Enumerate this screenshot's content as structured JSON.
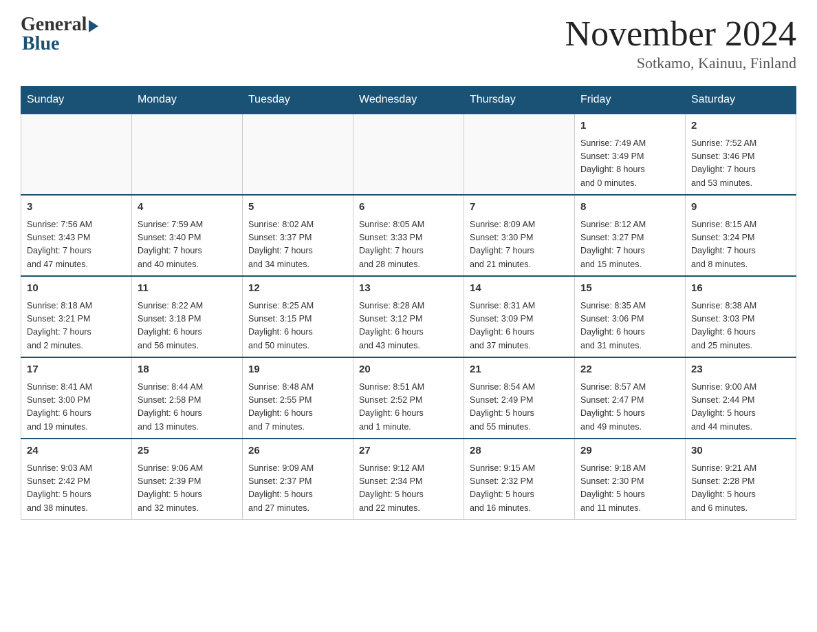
{
  "logo": {
    "general": "General",
    "blue": "Blue"
  },
  "title": "November 2024",
  "location": "Sotkamo, Kainuu, Finland",
  "days_of_week": [
    "Sunday",
    "Monday",
    "Tuesday",
    "Wednesday",
    "Thursday",
    "Friday",
    "Saturday"
  ],
  "weeks": [
    [
      {
        "day": "",
        "info": ""
      },
      {
        "day": "",
        "info": ""
      },
      {
        "day": "",
        "info": ""
      },
      {
        "day": "",
        "info": ""
      },
      {
        "day": "",
        "info": ""
      },
      {
        "day": "1",
        "info": "Sunrise: 7:49 AM\nSunset: 3:49 PM\nDaylight: 8 hours\nand 0 minutes."
      },
      {
        "day": "2",
        "info": "Sunrise: 7:52 AM\nSunset: 3:46 PM\nDaylight: 7 hours\nand 53 minutes."
      }
    ],
    [
      {
        "day": "3",
        "info": "Sunrise: 7:56 AM\nSunset: 3:43 PM\nDaylight: 7 hours\nand 47 minutes."
      },
      {
        "day": "4",
        "info": "Sunrise: 7:59 AM\nSunset: 3:40 PM\nDaylight: 7 hours\nand 40 minutes."
      },
      {
        "day": "5",
        "info": "Sunrise: 8:02 AM\nSunset: 3:37 PM\nDaylight: 7 hours\nand 34 minutes."
      },
      {
        "day": "6",
        "info": "Sunrise: 8:05 AM\nSunset: 3:33 PM\nDaylight: 7 hours\nand 28 minutes."
      },
      {
        "day": "7",
        "info": "Sunrise: 8:09 AM\nSunset: 3:30 PM\nDaylight: 7 hours\nand 21 minutes."
      },
      {
        "day": "8",
        "info": "Sunrise: 8:12 AM\nSunset: 3:27 PM\nDaylight: 7 hours\nand 15 minutes."
      },
      {
        "day": "9",
        "info": "Sunrise: 8:15 AM\nSunset: 3:24 PM\nDaylight: 7 hours\nand 8 minutes."
      }
    ],
    [
      {
        "day": "10",
        "info": "Sunrise: 8:18 AM\nSunset: 3:21 PM\nDaylight: 7 hours\nand 2 minutes."
      },
      {
        "day": "11",
        "info": "Sunrise: 8:22 AM\nSunset: 3:18 PM\nDaylight: 6 hours\nand 56 minutes."
      },
      {
        "day": "12",
        "info": "Sunrise: 8:25 AM\nSunset: 3:15 PM\nDaylight: 6 hours\nand 50 minutes."
      },
      {
        "day": "13",
        "info": "Sunrise: 8:28 AM\nSunset: 3:12 PM\nDaylight: 6 hours\nand 43 minutes."
      },
      {
        "day": "14",
        "info": "Sunrise: 8:31 AM\nSunset: 3:09 PM\nDaylight: 6 hours\nand 37 minutes."
      },
      {
        "day": "15",
        "info": "Sunrise: 8:35 AM\nSunset: 3:06 PM\nDaylight: 6 hours\nand 31 minutes."
      },
      {
        "day": "16",
        "info": "Sunrise: 8:38 AM\nSunset: 3:03 PM\nDaylight: 6 hours\nand 25 minutes."
      }
    ],
    [
      {
        "day": "17",
        "info": "Sunrise: 8:41 AM\nSunset: 3:00 PM\nDaylight: 6 hours\nand 19 minutes."
      },
      {
        "day": "18",
        "info": "Sunrise: 8:44 AM\nSunset: 2:58 PM\nDaylight: 6 hours\nand 13 minutes."
      },
      {
        "day": "19",
        "info": "Sunrise: 8:48 AM\nSunset: 2:55 PM\nDaylight: 6 hours\nand 7 minutes."
      },
      {
        "day": "20",
        "info": "Sunrise: 8:51 AM\nSunset: 2:52 PM\nDaylight: 6 hours\nand 1 minute."
      },
      {
        "day": "21",
        "info": "Sunrise: 8:54 AM\nSunset: 2:49 PM\nDaylight: 5 hours\nand 55 minutes."
      },
      {
        "day": "22",
        "info": "Sunrise: 8:57 AM\nSunset: 2:47 PM\nDaylight: 5 hours\nand 49 minutes."
      },
      {
        "day": "23",
        "info": "Sunrise: 9:00 AM\nSunset: 2:44 PM\nDaylight: 5 hours\nand 44 minutes."
      }
    ],
    [
      {
        "day": "24",
        "info": "Sunrise: 9:03 AM\nSunset: 2:42 PM\nDaylight: 5 hours\nand 38 minutes."
      },
      {
        "day": "25",
        "info": "Sunrise: 9:06 AM\nSunset: 2:39 PM\nDaylight: 5 hours\nand 32 minutes."
      },
      {
        "day": "26",
        "info": "Sunrise: 9:09 AM\nSunset: 2:37 PM\nDaylight: 5 hours\nand 27 minutes."
      },
      {
        "day": "27",
        "info": "Sunrise: 9:12 AM\nSunset: 2:34 PM\nDaylight: 5 hours\nand 22 minutes."
      },
      {
        "day": "28",
        "info": "Sunrise: 9:15 AM\nSunset: 2:32 PM\nDaylight: 5 hours\nand 16 minutes."
      },
      {
        "day": "29",
        "info": "Sunrise: 9:18 AM\nSunset: 2:30 PM\nDaylight: 5 hours\nand 11 minutes."
      },
      {
        "day": "30",
        "info": "Sunrise: 9:21 AM\nSunset: 2:28 PM\nDaylight: 5 hours\nand 6 minutes."
      }
    ]
  ]
}
